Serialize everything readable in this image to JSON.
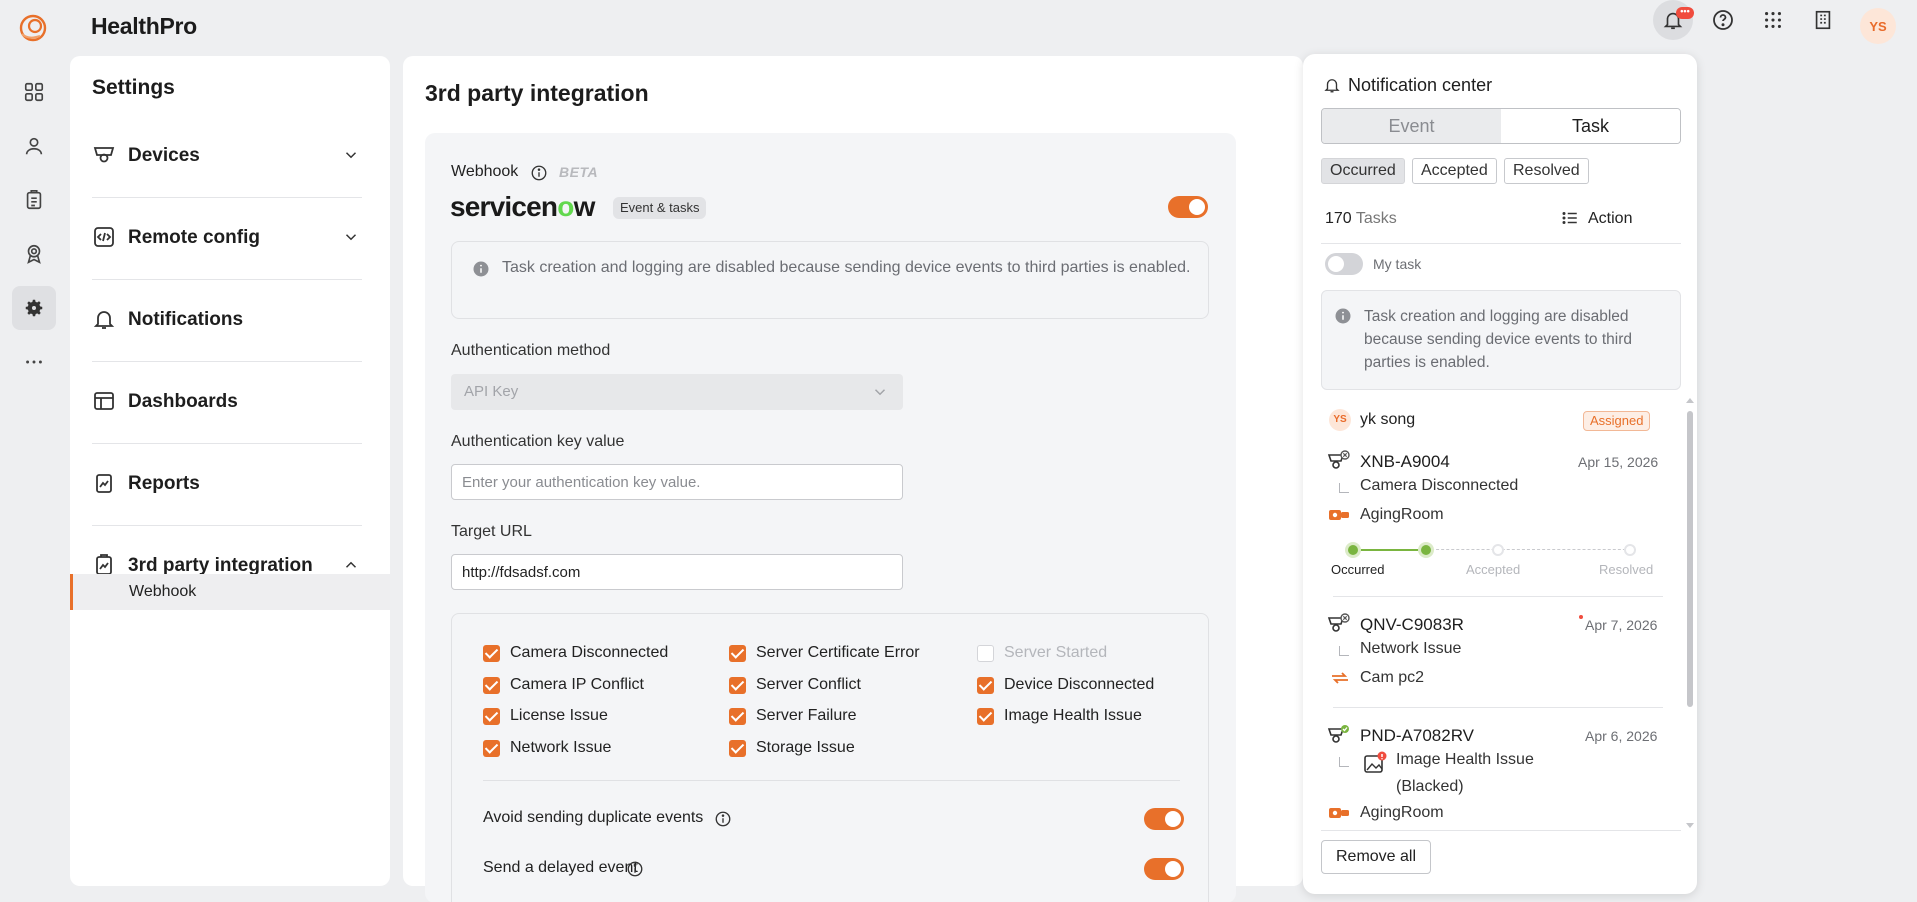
{
  "app": {
    "name": "HealthPro",
    "user_initials": "YS",
    "bell_badge": "•••"
  },
  "settings": {
    "title": "Settings",
    "menu": [
      {
        "label": "Devices"
      },
      {
        "label": "Remote config"
      },
      {
        "label": "Notifications"
      },
      {
        "label": "Dashboards"
      },
      {
        "label": "Reports"
      },
      {
        "label": "3rd party integration"
      }
    ],
    "submenu_active": "Webhook"
  },
  "main": {
    "title": "3rd party integration",
    "webhook_label": "Webhook",
    "beta": "BETA",
    "provider": {
      "name_pre": "servicen",
      "name_o": "o",
      "name_post": "w"
    },
    "tag": "Event & tasks",
    "webhook_enabled": true,
    "alert": "Task creation and logging are disabled because sending device events to third parties is enabled.",
    "auth_method_label": "Authentication method",
    "auth_method_value": "API Key",
    "auth_key_label": "Authentication key value",
    "auth_key_placeholder": "Enter your authentication key value.",
    "target_url_label": "Target URL",
    "target_url_value": "http://fdsadsf.com",
    "events": [
      {
        "label": "Camera Disconnected",
        "checked": true
      },
      {
        "label": "Camera IP Conflict",
        "checked": true
      },
      {
        "label": "License Issue",
        "checked": true
      },
      {
        "label": "Network Issue",
        "checked": true
      },
      {
        "label": "Server Certificate Error",
        "checked": true
      },
      {
        "label": "Server Conflict",
        "checked": true
      },
      {
        "label": "Server Failure",
        "checked": true
      },
      {
        "label": "Storage Issue",
        "checked": true
      },
      {
        "label": "Server Started",
        "checked": false
      },
      {
        "label": "Device Disconnected",
        "checked": true
      },
      {
        "label": "Image Health Issue",
        "checked": true
      }
    ],
    "avoid_duplicates_label": "Avoid sending duplicate events",
    "avoid_duplicates_enabled": true,
    "delayed_event_label": "Send a delayed event",
    "delayed_event_enabled": true
  },
  "notification_center": {
    "title": "Notification center",
    "tabs": [
      "Event",
      "Task"
    ],
    "active_tab": "Task",
    "filters": [
      "Occurred",
      "Accepted",
      "Resolved"
    ],
    "active_filter": "Occurred",
    "count": "170",
    "count_unit": "Tasks",
    "action_label": "Action",
    "my_task_label": "My task",
    "my_task_enabled": false,
    "alert": "Task creation and logging are disabled because sending device events to third parties is enabled.",
    "assignee": {
      "initials": "YS",
      "name": "yk song",
      "status": "Assigned"
    },
    "tasks": [
      {
        "device": "XNB-A9004",
        "date": "Apr 15, 2026",
        "event": "Camera Disconnected",
        "location": "AgingRoom"
      },
      {
        "device": "QNV-C9083R",
        "date": "Apr 7, 2026",
        "event": "Network Issue",
        "location": "Cam pc2"
      },
      {
        "device": "PND-A7082RV",
        "date": "Apr 6, 2026",
        "event": "Image Health Issue",
        "event_detail": "(Blacked)",
        "location": "AgingRoom"
      }
    ],
    "steps": [
      "Occurred",
      "Accepted",
      "Resolved"
    ],
    "remove_all": "Remove all"
  },
  "colors": {
    "accent": "#e8702a",
    "success": "#7ab540"
  }
}
